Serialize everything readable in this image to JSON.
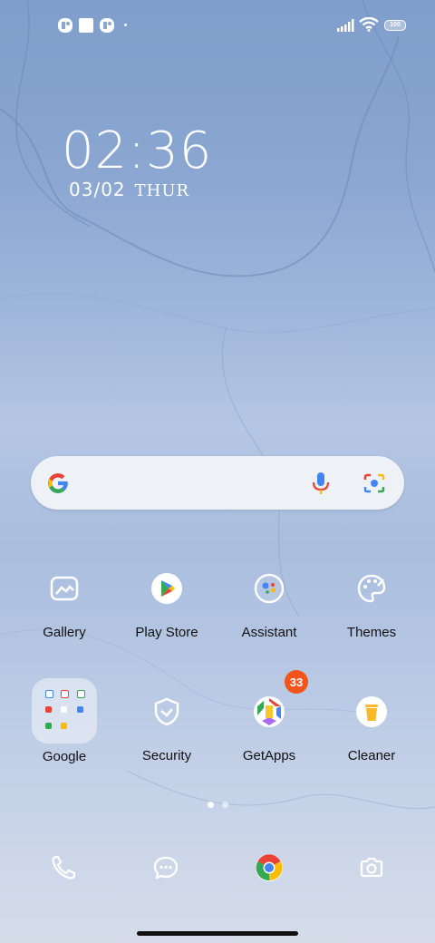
{
  "status_bar": {
    "notification_icons": [
      "notification-app-icon",
      "square-notification-icon",
      "notification-app-icon"
    ],
    "signal": "signal-icon",
    "wifi": "wifi-icon",
    "battery_level": "100"
  },
  "clock": {
    "time": "02:36",
    "date": "03/02",
    "weekday": "THUR"
  },
  "search": {
    "google_logo": "google-g-icon",
    "mic": "mic-icon",
    "lens": "lens-icon"
  },
  "apps_row1": [
    {
      "label": "Gallery",
      "icon": "gallery-icon"
    },
    {
      "label": "Play Store",
      "icon": "play-store-icon"
    },
    {
      "label": "Assistant",
      "icon": "assistant-icon"
    },
    {
      "label": "Themes",
      "icon": "palette-icon"
    }
  ],
  "apps_row2": [
    {
      "label": "Google",
      "icon": "folder-icon"
    },
    {
      "label": "Security",
      "icon": "shield-icon"
    },
    {
      "label": "GetApps",
      "icon": "getapps-icon",
      "badge": "33"
    },
    {
      "label": "Cleaner",
      "icon": "trash-icon"
    }
  ],
  "pager": {
    "pages": 2,
    "active": 1
  },
  "dock": [
    "phone-icon",
    "messages-icon",
    "chrome-icon",
    "camera-icon"
  ],
  "colors": {
    "badge": "#f2541b",
    "accent_blue": "#4285f4",
    "accent_red": "#ea4335",
    "accent_yellow": "#fbbc05",
    "accent_green": "#34a853"
  }
}
